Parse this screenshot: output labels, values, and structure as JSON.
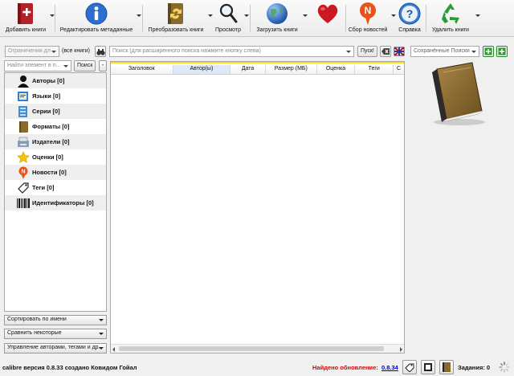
{
  "toolbar": {
    "items": [
      {
        "label": "Добавить книги",
        "icon": "add-book-icon"
      },
      {
        "label": "Редактировать метаданные",
        "icon": "info-icon"
      },
      {
        "label": "Преобразовать книги",
        "icon": "convert-book-icon"
      },
      {
        "label": "Просмотр",
        "icon": "magnifier-icon"
      },
      {
        "label": "Загрузить книги",
        "icon": "globe-icon"
      },
      {
        "label": "",
        "icon": "heart-icon"
      },
      {
        "label": "Сбор новостей",
        "icon": "news-icon"
      },
      {
        "label": "Справка",
        "icon": "help-icon"
      },
      {
        "label": "Удалить книги",
        "icon": "recycle-icon"
      }
    ]
  },
  "search": {
    "restriction": "Ограничения дл",
    "all_books": "(все книги)",
    "placeholder": "Поиск (для расширенного поиска нажмите кнопку слева)",
    "go_label": "Пуск!",
    "saved_searches": "Сохранённые Поиски"
  },
  "tag_browser": {
    "find_placeholder": "Найти элемент в п...",
    "find_button": "Поиск",
    "collapse_button": "-",
    "categories": [
      {
        "label": "Авторы [0]",
        "icon": "authors-icon"
      },
      {
        "label": "Языки [0]",
        "icon": "languages-icon"
      },
      {
        "label": "Серии [0]",
        "icon": "series-icon"
      },
      {
        "label": "Форматы [0]",
        "icon": "formats-icon"
      },
      {
        "label": "Издатели [0]",
        "icon": "publishers-icon"
      },
      {
        "label": "Оценки [0]",
        "icon": "ratings-icon"
      },
      {
        "label": "Новости [0]",
        "icon": "news-icon"
      },
      {
        "label": "Теги [0]",
        "icon": "tags-icon"
      },
      {
        "label": "Идентификаторы [0]",
        "icon": "barcode-icon"
      }
    ],
    "sort_by": "Сортировать по имени",
    "match": "Сравнить некоторые",
    "manage": "Управление авторами, тегами и др."
  },
  "book_table": {
    "columns": [
      "Заголовок",
      "Автор(ы)",
      "Дата",
      "Размер (МБ)",
      "Оценка",
      "Теги",
      "С"
    ]
  },
  "status": {
    "version": "calibre версия 0.8.33 создано Ковидом Гойал",
    "update_label": "Найдено обновление:",
    "update_version": "0.8.34",
    "jobs": "Задания: 0"
  },
  "colors": {
    "update_red": "#e00000",
    "link_blue": "#0000cc",
    "search_highlight": "#f1e21a"
  }
}
